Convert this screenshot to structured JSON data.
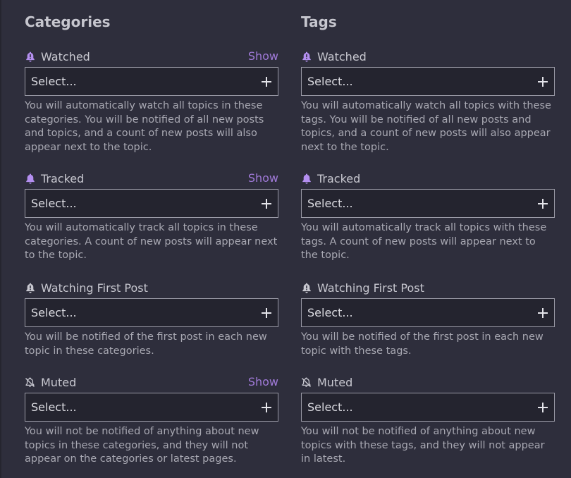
{
  "categories": {
    "heading": "Categories",
    "groups": [
      {
        "label": "Watched",
        "icon": "bell-icon",
        "show": "Show",
        "placeholder": "Select...",
        "description": "You will automatically watch all topics in these categories. You will be notified of all new posts and topics, and a count of new posts will also appear next to the topic."
      },
      {
        "label": "Tracked",
        "icon": "bell-icon",
        "show": "Show",
        "placeholder": "Select...",
        "description": "You will automatically track all topics in these categories. A count of new posts will appear next to the topic."
      },
      {
        "label": "Watching First Post",
        "icon": "bell-exclamation-icon",
        "placeholder": "Select...",
        "description": "You will be notified of the first post in each new topic in these categories."
      },
      {
        "label": "Muted",
        "icon": "bell-slash-icon",
        "show": "Show",
        "placeholder": "Select...",
        "description": "You will not be notified of anything about new topics in these categories, and they will not appear on the categories or latest pages."
      }
    ]
  },
  "tags": {
    "heading": "Tags",
    "groups": [
      {
        "label": "Watched",
        "icon": "bell-exclamation-icon",
        "placeholder": "Select...",
        "description": "You will automatically watch all topics with these tags. You will be notified of all new posts and topics, and a count of new posts will also appear next to the topic."
      },
      {
        "label": "Tracked",
        "icon": "bell-icon",
        "placeholder": "Select...",
        "description": "You will automatically track all topics with these tags. A count of new posts will appear next to the topic."
      },
      {
        "label": "Watching First Post",
        "icon": "bell-exclamation-icon",
        "placeholder": "Select...",
        "description": "You will be notified of the first post in each new topic with these tags."
      },
      {
        "label": "Muted",
        "icon": "bell-slash-icon",
        "placeholder": "Select...",
        "description": "You will not be notified of anything about new topics with these tags, and they will not appear in latest."
      }
    ]
  },
  "colors": {
    "background": "#2e2e3c",
    "accent": "#a07ad8",
    "bell_watched": "#b48ff0",
    "bell_neutral": "#c8c8d0"
  }
}
